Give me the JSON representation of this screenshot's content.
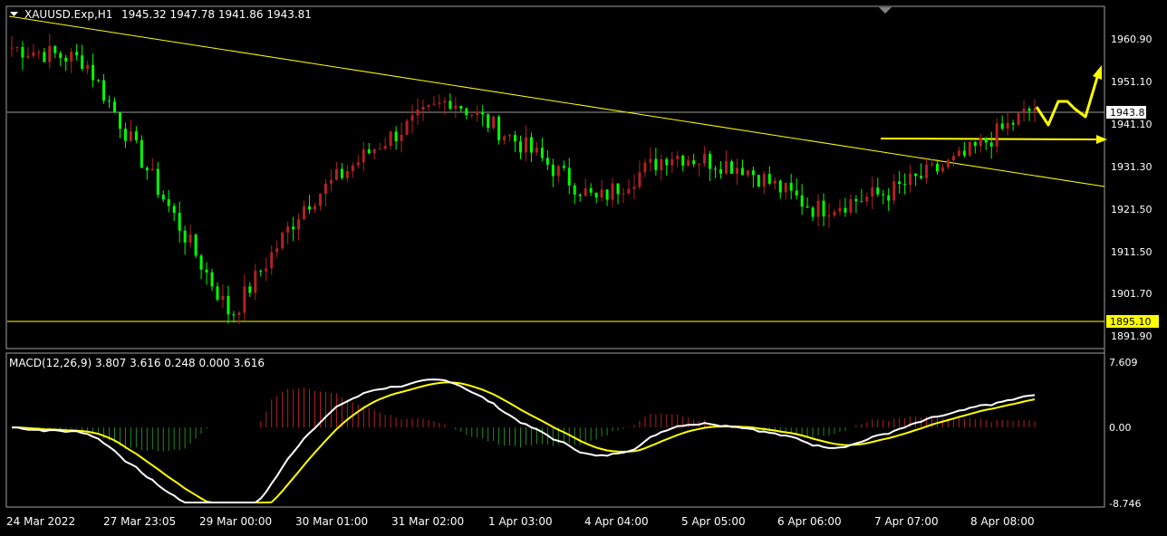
{
  "header": {
    "symbol_text": "XAUUSD.Exp,H1",
    "ohlc_text": "1945.32 1947.78 1941.86 1943.81"
  },
  "price_axis": {
    "labels": [
      "1960.90",
      "1951.10",
      "1941.10",
      "1931.30",
      "1921.50",
      "1911.50",
      "1901.70",
      "1891.90"
    ],
    "current_price": "1943.81",
    "support_level_label": "1895.10"
  },
  "time_axis": {
    "labels": [
      "24 Mar 2022",
      "27 Mar 23:05",
      "29 Mar 00:00",
      "30 Mar 01:00",
      "31 Mar 02:00",
      "1 Apr 03:00",
      "4 Apr 04:00",
      "5 Apr 05:00",
      "6 Apr 06:00",
      "7 Apr 07:00",
      "8 Apr 08:00"
    ]
  },
  "macd": {
    "label": "MACD(12,26,9) 3.807 3.616 0.248 0.000 3.616",
    "axis_labels": [
      "7.609",
      "0.00",
      "-8.746"
    ]
  },
  "colors": {
    "bull_candle": "#b22222",
    "bear_candle": "#00ff00",
    "trendline": "#ffff00",
    "grid_line": "#c0c0c0",
    "macd_line": "#ffffff",
    "signal_line": "#ffff00",
    "hist_pos": "#b22222",
    "hist_neg": "#228b22"
  },
  "chart_data": {
    "type": "candlestick",
    "symbol": "XAUUSD.Exp",
    "timeframe": "H1",
    "last_bar": {
      "open": 1945.32,
      "high": 1947.78,
      "low": 1941.86,
      "close": 1943.81
    },
    "support_level": 1895.1,
    "price_range": [
      1888,
      1967
    ],
    "close_series": [
      {
        "t": "24 Mar 2022",
        "close": 1958
      },
      {
        "t": "27 Mar 23:05",
        "close": 1955
      },
      {
        "t": "28 Mar",
        "close": 1925
      },
      {
        "t": "29 Mar 00:00",
        "close": 1895
      },
      {
        "t": "30 Mar 01:00",
        "close": 1921
      },
      {
        "t": "30 Mar",
        "close": 1935
      },
      {
        "t": "31 Mar 02:00",
        "close": 1946
      },
      {
        "t": "1 Apr 03:00",
        "close": 1935
      },
      {
        "t": "1 Apr",
        "close": 1922
      },
      {
        "t": "4 Apr 04:00",
        "close": 1933
      },
      {
        "t": "5 Apr 05:00",
        "close": 1930
      },
      {
        "t": "5 Apr",
        "close": 1920
      },
      {
        "t": "6 Apr 06:00",
        "close": 1924
      },
      {
        "t": "7 Apr 07:00",
        "close": 1932
      },
      {
        "t": "8 Apr 08:00",
        "close": 1944
      }
    ],
    "macd": {
      "params": "12,26,9",
      "main": 3.807,
      "signal": 3.616,
      "histogram": 0.248,
      "range": [
        -8.746,
        7.609
      ]
    }
  }
}
